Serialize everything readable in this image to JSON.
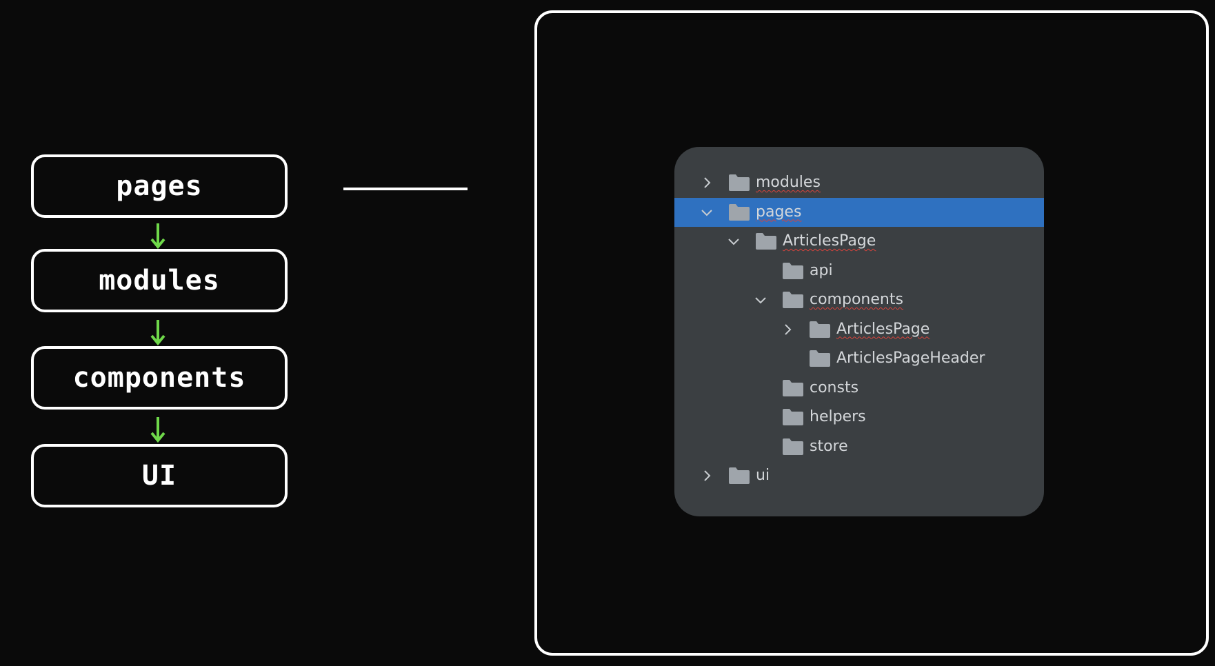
{
  "layers": [
    "pages",
    "modules",
    "components",
    "UI"
  ],
  "tree": {
    "rows": [
      {
        "label": "modules",
        "depth": 0,
        "chevron": "collapsed",
        "squiggle": true,
        "selected": false
      },
      {
        "label": "pages",
        "depth": 0,
        "chevron": "expanded",
        "squiggle": true,
        "selected": true
      },
      {
        "label": "ArticlesPage",
        "depth": 1,
        "chevron": "expanded",
        "squiggle": true,
        "selected": false
      },
      {
        "label": "api",
        "depth": 2,
        "chevron": "none",
        "squiggle": false,
        "selected": false
      },
      {
        "label": "components",
        "depth": 2,
        "chevron": "expanded",
        "squiggle": true,
        "selected": false
      },
      {
        "label": "ArticlesPage",
        "depth": 3,
        "chevron": "collapsed",
        "squiggle": true,
        "selected": false
      },
      {
        "label": "ArticlesPageHeader",
        "depth": 3,
        "chevron": "none",
        "squiggle": false,
        "selected": false
      },
      {
        "label": "consts",
        "depth": 2,
        "chevron": "none",
        "squiggle": false,
        "selected": false
      },
      {
        "label": "helpers",
        "depth": 2,
        "chevron": "none",
        "squiggle": false,
        "selected": false
      },
      {
        "label": "store",
        "depth": 2,
        "chevron": "none",
        "squiggle": false,
        "selected": false
      },
      {
        "label": "ui",
        "depth": 0,
        "chevron": "collapsed",
        "squiggle": false,
        "selected": false
      }
    ]
  },
  "colors": {
    "background": "#0a0a0a",
    "arrow": "#6fd84a",
    "panel": "#3b3f42",
    "selection": "#2f71c0",
    "folder": "#9fa5ab",
    "text": "#d4d7da",
    "spell_underline": "#d8443c"
  },
  "icons": {
    "layer_arrow": "arrow-down-icon",
    "folder": "folder-icon",
    "expanded": "chevron-down-icon",
    "collapsed": "chevron-right-icon"
  }
}
